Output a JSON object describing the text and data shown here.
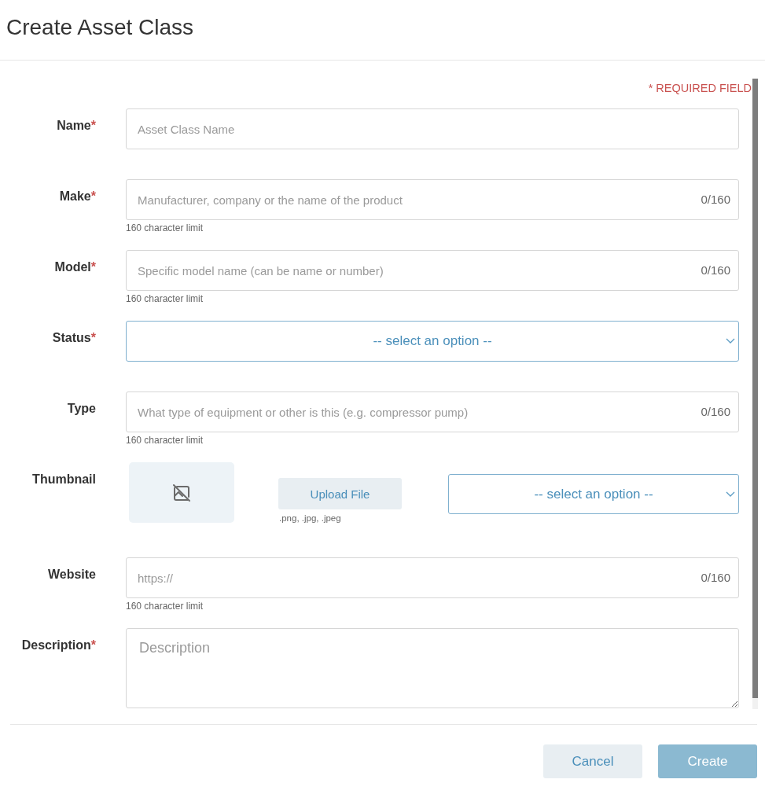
{
  "header": {
    "title": "Create Asset Class"
  },
  "required_note": "* REQUIRED FIELD",
  "fields": [
    {
      "kind": "text",
      "label": "Name",
      "required_mark": "*",
      "placeholder": "Asset Class Name"
    },
    {
      "kind": "text",
      "label": "Make",
      "required_mark": "*",
      "placeholder": "Manufacturer, company or the name of the product",
      "counter": "0/160",
      "hint": "160 character limit"
    },
    {
      "kind": "text",
      "label": "Model",
      "required_mark": "*",
      "placeholder": "Specific model name (can be name or number)",
      "counter": "0/160",
      "hint": "160 character limit"
    },
    {
      "kind": "select",
      "label": "Status",
      "required_mark": "*",
      "value": "-- select an option --"
    },
    {
      "kind": "text",
      "label": "Type",
      "placeholder": "What type of equipment or other is this (e.g. compressor pump)",
      "counter": "0/160",
      "hint": "160 character limit"
    },
    {
      "kind": "thumbnail",
      "label": "Thumbnail",
      "upload_button": "Upload File",
      "file_types": ".png, .jpg, .jpeg",
      "select_value": "-- select an option --"
    },
    {
      "kind": "text",
      "label": "Website",
      "placeholder": "https://",
      "counter": "0/160",
      "hint": "160 character limit"
    },
    {
      "kind": "textarea",
      "label": "Description",
      "required_mark": "*",
      "placeholder": "Description"
    }
  ],
  "buttons": [
    {
      "label": "Cancel",
      "kind": "secondary",
      "disabled": false
    },
    {
      "label": "Create",
      "kind": "primary",
      "disabled": true
    }
  ]
}
